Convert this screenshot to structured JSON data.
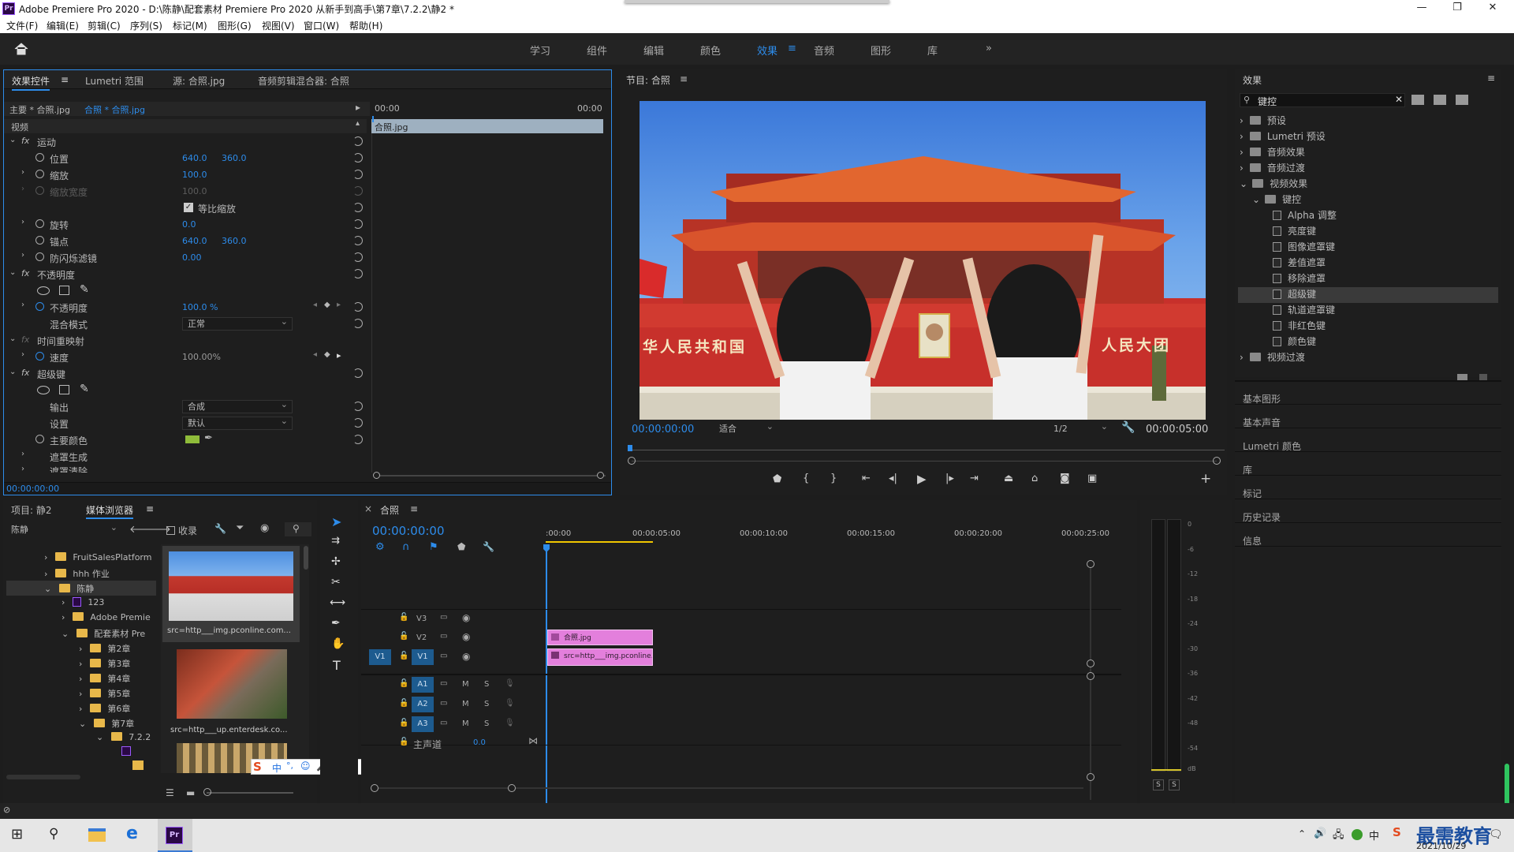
{
  "title": "Adobe Premiere Pro 2020 - D:\\陈静\\配套素材 Premiere Pro 2020 从新手到高手\\第7章\\7.2.2\\静2 *",
  "app_badge": "Pr",
  "window_controls": [
    "—",
    "❐",
    "✕"
  ],
  "menu": [
    "文件(F)",
    "编辑(E)",
    "剪辑(C)",
    "序列(S)",
    "标记(M)",
    "图形(G)",
    "视图(V)",
    "窗口(W)",
    "帮助(H)"
  ],
  "workspaces": [
    "学习",
    "组件",
    "编辑",
    "颜色",
    "效果",
    "音频",
    "图形",
    "库",
    "»"
  ],
  "active_workspace": "效果",
  "effect_controls": {
    "tabs": [
      "效果控件",
      "Lumetri 范围",
      "源: 合照.jpg",
      "音频剪辑混合器: 合照"
    ],
    "master": "主要 * 合照.jpg",
    "clip": "合照 * 合照.jpg",
    "tc_start": "00:00",
    "tc_end": "00:00",
    "clip_bar": "合照.jpg",
    "section": "视频",
    "rows": [
      {
        "label": "运动",
        "fx": true
      },
      {
        "label": "位置",
        "v1": "640.0",
        "v2": "360.0"
      },
      {
        "label": "缩放",
        "v1": "100.0"
      },
      {
        "label": "缩放宽度",
        "v1": "100.0",
        "disabled": true
      },
      {
        "label": "等比缩放",
        "checkbox": true
      },
      {
        "label": "旋转",
        "v1": "0.0"
      },
      {
        "label": "锚点",
        "v1": "640.0",
        "v2": "360.0"
      },
      {
        "label": "防闪烁滤镜",
        "v1": "0.00"
      },
      {
        "label": "不透明度",
        "fx": true
      },
      {
        "label": "不透明度",
        "v1": "100.0 %"
      },
      {
        "label": "混合模式",
        "dd": "正常"
      },
      {
        "label": "时间重映射",
        "fx": true
      },
      {
        "label": "速度",
        "v1": "100.00%"
      },
      {
        "label": "超级键",
        "fx": true
      },
      {
        "label": "输出",
        "dd": "合成"
      },
      {
        "label": "设置",
        "dd": "默认"
      },
      {
        "label": "主要颜色"
      },
      {
        "label": "遮罩生成"
      },
      {
        "label": "遮罩清除"
      }
    ],
    "timecode": "00:00:00:00"
  },
  "program": {
    "title": "节目: 合照",
    "timecode": "00:00:00:00",
    "fit": "适合",
    "res": "1/2",
    "duration": "00:00:05:00",
    "banner_left": "华人民共和国",
    "banner_right": "人民大团"
  },
  "effects": {
    "title": "效果",
    "search": "键控",
    "tree": [
      {
        "label": "预设",
        "d": 0,
        "open": false
      },
      {
        "label": "Lumetri 预设",
        "d": 0,
        "open": false
      },
      {
        "label": "音频效果",
        "d": 0,
        "open": false
      },
      {
        "label": "音频过渡",
        "d": 0,
        "open": false
      },
      {
        "label": "视频效果",
        "d": 0,
        "open": true
      },
      {
        "label": "键控",
        "d": 1,
        "open": true
      },
      {
        "label": "Alpha 调整",
        "d": 2
      },
      {
        "label": "亮度键",
        "d": 2
      },
      {
        "label": "图像遮罩键",
        "d": 2
      },
      {
        "label": "差值遮罩",
        "d": 2
      },
      {
        "label": "移除遮罩",
        "d": 2
      },
      {
        "label": "超级键",
        "d": 2,
        "sel": true
      },
      {
        "label": "轨道遮罩键",
        "d": 2
      },
      {
        "label": "非红色键",
        "d": 2
      },
      {
        "label": "颜色键",
        "d": 2
      },
      {
        "label": "视频过渡",
        "d": 0,
        "open": false
      }
    ],
    "collapsed": [
      "基本图形",
      "基本声音",
      "Lumetri 颜色",
      "库",
      "标记",
      "历史记录",
      "信息"
    ]
  },
  "project": {
    "tabs": [
      "项目: 静2",
      "媒体浏览器"
    ],
    "location": "陈静",
    "collect": "收录",
    "tree": [
      {
        "label": "FruitSalesPlatform",
        "d": 0
      },
      {
        "label": "hhh 作业",
        "d": 0
      },
      {
        "label": "陈静",
        "d": 0,
        "open": true
      },
      {
        "label": "123",
        "d": 1,
        "pr": true
      },
      {
        "label": "Adobe Premie",
        "d": 1
      },
      {
        "label": "配套素材 Pre",
        "d": 1,
        "open": true
      },
      {
        "label": "第2章",
        "d": 2
      },
      {
        "label": "第3章",
        "d": 2
      },
      {
        "label": "第4章",
        "d": 2
      },
      {
        "label": "第5章",
        "d": 2
      },
      {
        "label": "第6章",
        "d": 2
      },
      {
        "label": "第7章",
        "d": 2,
        "open": true
      },
      {
        "label": "7.2.2",
        "d": 3,
        "open": true
      }
    ],
    "thumbs": [
      "src=http___img.pconline.com...",
      "src=http___up.enterdesk.co..."
    ]
  },
  "timeline": {
    "title": "合照",
    "timecode": "00:00:00:00",
    "ticks": [
      ":00:00",
      "00:00:05:00",
      "00:00:10:00",
      "00:00:15:00",
      "00:00:20:00",
      "00:00:25:00"
    ],
    "video_tracks": [
      "V3",
      "V2",
      "V1"
    ],
    "audio_tracks": [
      "A1",
      "A2",
      "A3"
    ],
    "master": "主声道",
    "master_val": "0.0",
    "clip_v2": "合照.jpg",
    "clip_v1": "src=http___img.pconline...",
    "ms": [
      "M",
      "S"
    ]
  },
  "meter": {
    "labels": [
      "0",
      "-6",
      "-12",
      "-18",
      "-24",
      "-30",
      "-36",
      "-42",
      "-48",
      "-54",
      "dB"
    ],
    "solo": [
      "S",
      "S"
    ]
  },
  "taskbar": {
    "date": "2021/10/29",
    "brand": "最需教育",
    "ime": "中"
  }
}
